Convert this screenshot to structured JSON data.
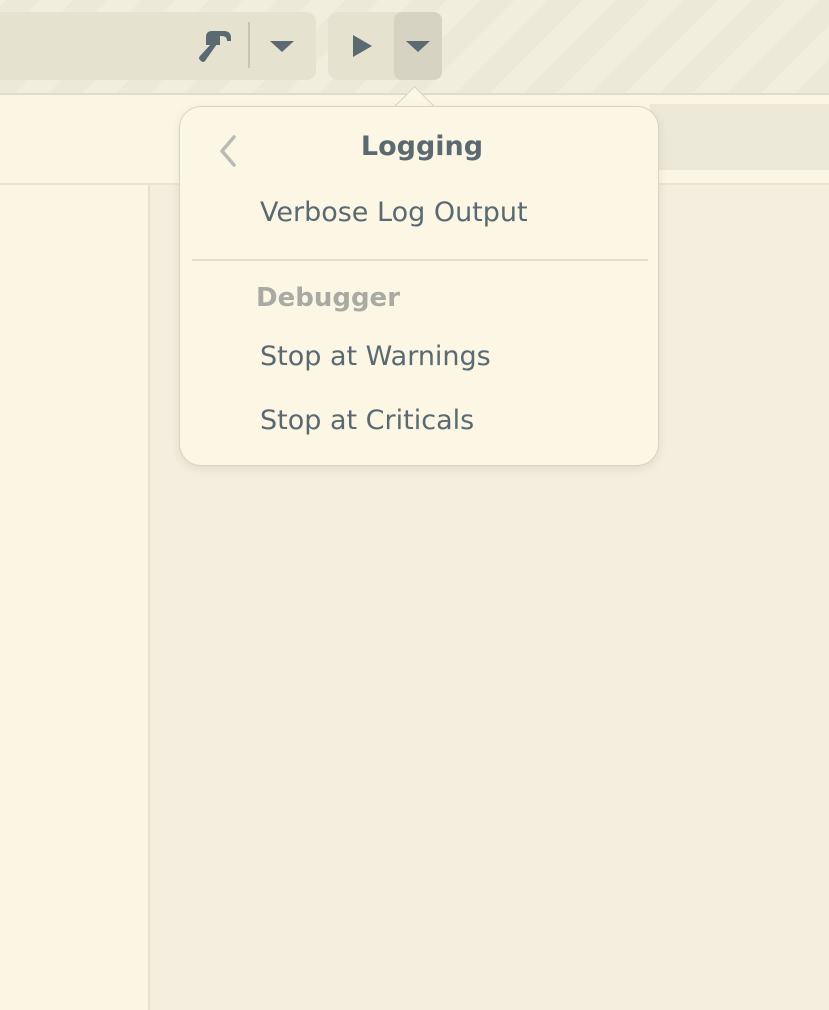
{
  "headerbar": {
    "build_button_icon": "hammer-icon",
    "build_menu_icon": "pan-down-icon",
    "run_button_icon": "play-icon",
    "run_menu_icon": "pan-down-icon"
  },
  "popover": {
    "back_icon": "go-previous-icon",
    "title": "Logging",
    "items": [
      {
        "label": "Verbose Log Output"
      }
    ],
    "section": {
      "label": "Debugger",
      "items": [
        {
          "label": "Stop at Warnings"
        },
        {
          "label": "Stop at Criticals"
        }
      ]
    }
  },
  "colors": {
    "background": "#f3eedd",
    "popover_bg": "#fcf6e5",
    "text": "#5a6a70",
    "muted_text": "#a9aba2",
    "button_bg": "#e6e2d0",
    "active_button_bg": "#d7d3c2"
  }
}
